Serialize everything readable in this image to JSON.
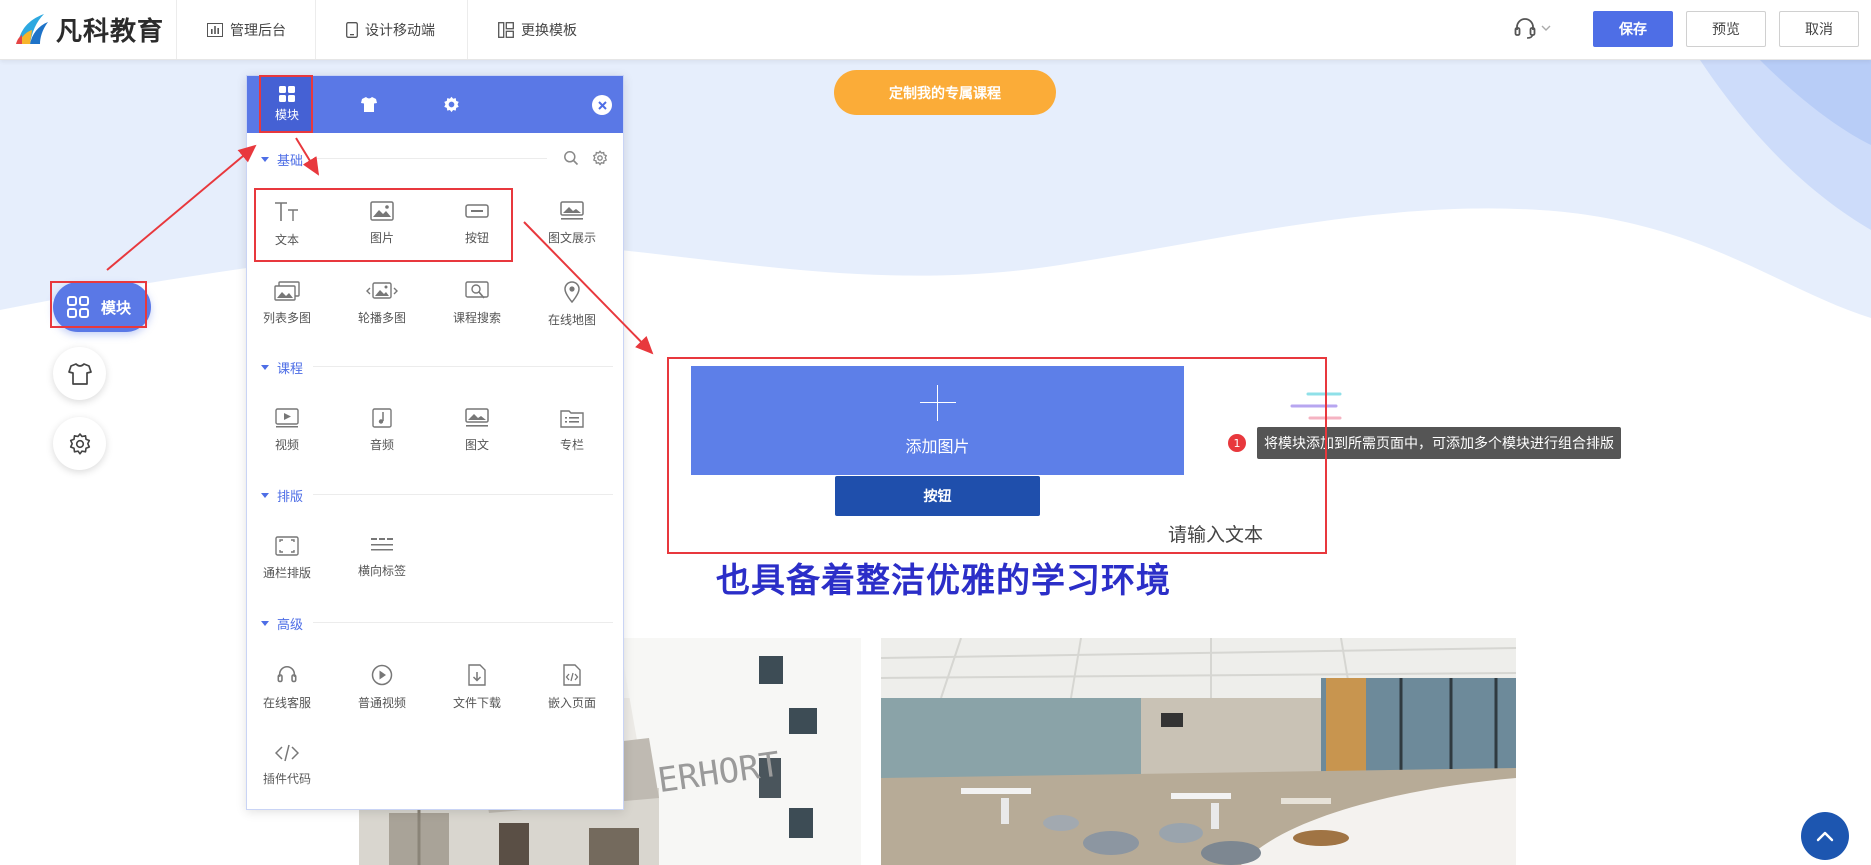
{
  "brand": {
    "name": "凡科教育"
  },
  "topnav": [
    {
      "label": "管理后台",
      "icon": "bar-chart-icon"
    },
    {
      "label": "设计移动端",
      "icon": "mobile-icon"
    },
    {
      "label": "更换模板",
      "icon": "template-icon"
    }
  ],
  "actions": {
    "save": "保存",
    "preview": "预览",
    "cancel": "取消"
  },
  "float_toolbar": {
    "module_label": "模块"
  },
  "panel": {
    "tabs": [
      {
        "label": "模块",
        "icon": "grid-icon"
      },
      {
        "label": "",
        "icon": "shirt-icon"
      },
      {
        "label": "",
        "icon": "gear-icon"
      }
    ],
    "sections": [
      {
        "title": "基础",
        "items": [
          "文本",
          "图片",
          "按钮",
          "图文展示",
          "列表多图",
          "轮播多图",
          "课程搜索",
          "在线地图"
        ]
      },
      {
        "title": "课程",
        "items": [
          "视频",
          "音频",
          "图文",
          "专栏"
        ]
      },
      {
        "title": "排版",
        "items": [
          "通栏排版",
          "横向标签"
        ]
      },
      {
        "title": "高级",
        "items": [
          "在线客服",
          "普通视频",
          "文件下载",
          "嵌入页面",
          "插件代码"
        ]
      }
    ]
  },
  "canvas": {
    "cta": "定制我的专属课程",
    "add_image": "添加图片",
    "button": "按钮",
    "text_placeholder": "请输入文本",
    "headline": "也具备着整洁优雅的学习环境"
  },
  "tooltip": {
    "step": "1",
    "text": "将模块添加到所需页面中，可添加多个模块进行组合排版"
  },
  "colors": {
    "accent": "#5a78e6",
    "save": "#4e6ee6",
    "cta": "#fbac38",
    "headline": "#2b2ec8",
    "annotation": "#e8383d"
  }
}
